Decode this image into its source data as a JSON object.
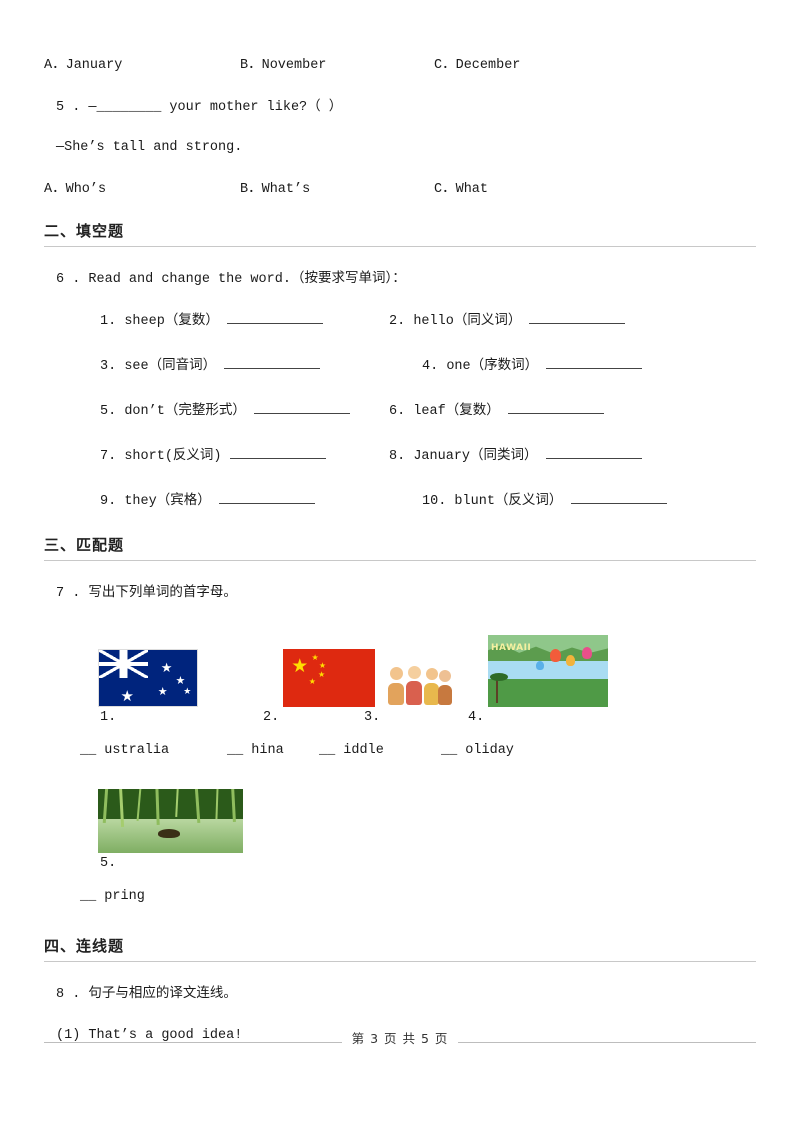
{
  "page": {
    "footer": "第 3 页 共 5 页"
  },
  "q4_choices": {
    "a": "A．January",
    "b": "B．November",
    "c": "C．December"
  },
  "q5": {
    "stem": "5 .  —________ your mother like?（      ）",
    "answer_line": "—She’s tall and strong.",
    "a": "A．Who’s",
    "b": "B．What’s",
    "c": "C．What"
  },
  "section2": {
    "title": "二、填空题",
    "q6_stem": "6 .  Read and change the word.（按要求写单词）：",
    "items": [
      {
        "num": "1.",
        "word": "sheep（复数）"
      },
      {
        "num": "2.",
        "word": "hello（同义词）"
      },
      {
        "num": "3.",
        "word": "see（同音词）"
      },
      {
        "num": "4.",
        "word": "one（序数词）"
      },
      {
        "num": "5.",
        "word": "don’t（完整形式）"
      },
      {
        "num": "6.",
        "word": "leaf（复数）"
      },
      {
        "num": "7.",
        "word": "short(反义词)"
      },
      {
        "num": "8.",
        "word": "January（同类词）"
      },
      {
        "num": "9.",
        "word": "they（宾格）"
      },
      {
        "num": "10.",
        "word": "blunt（反义词）"
      }
    ]
  },
  "section3": {
    "title": "三、匹配题",
    "q7_stem": "7 .  写出下列单词的首字母。",
    "pictures": [
      {
        "num": "1.",
        "name": "australia-flag"
      },
      {
        "num": "2.",
        "name": "china-flag"
      },
      {
        "num": "3.",
        "name": "kids-photo"
      },
      {
        "num": "4.",
        "name": "holiday-scene"
      },
      {
        "num": "5.",
        "name": "spring-scene"
      }
    ],
    "answers_row1": [
      "__ ustralia",
      "__ hina",
      "__ iddle",
      "__ oliday"
    ],
    "answers_row2": [
      "__ pring"
    ]
  },
  "section4": {
    "title": "四、连线题",
    "q8_stem": "8 .  句子与相应的译文连线。",
    "item1": "(1) That’s a good idea!"
  }
}
